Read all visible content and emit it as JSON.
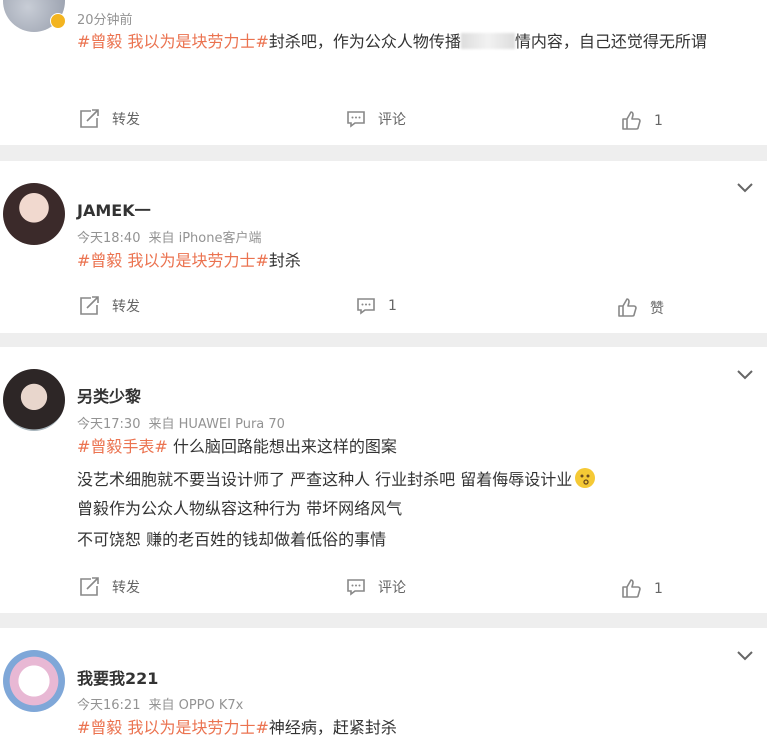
{
  "posts": [
    {
      "time": "20分钟前",
      "source": "",
      "topic": "#曾毅 我以为是块劳力士#",
      "text_before": "封杀吧，作为公众人物传播",
      "text_after": "情内容，自己还觉得无所谓",
      "actions": {
        "repost": "转发",
        "comment": "评论",
        "like": "1"
      }
    },
    {
      "name": "JAMEK一",
      "time": "今天18:40",
      "source": "来自 iPhone客户端",
      "topic": "#曾毅 我以为是块劳力士#",
      "text": "封杀",
      "actions": {
        "repost": "转发",
        "comment": "1",
        "like": "赞"
      }
    },
    {
      "name": "另类少黎",
      "time": "今天17:30",
      "source": "来自 HUAWEI Pura 70",
      "topic": "#曾毅手表#",
      "lines": [
        " 什么脑回路能想出来这样的图案",
        "没艺术细胞就不要当设计师了 严查这种人 行业封杀吧 留着侮辱设计业",
        "曾毅作为公众人物纵容这种行为 带坏网络风气",
        "不可饶恕 赚的老百姓的钱却做着低俗的事情"
      ],
      "actions": {
        "repost": "转发",
        "comment": "评论",
        "like": "1"
      }
    },
    {
      "name": "我要我221",
      "time": "今天16:21",
      "source": "来自 OPPO K7x",
      "topic": "#曾毅 我以为是块劳力士#",
      "text": "神经病，赶紧封杀"
    }
  ],
  "colors": {
    "topic": "#eb7350",
    "meta": "#939393",
    "background": "#eeeeee",
    "badge": "#f3b420"
  },
  "icons": [
    "repost-icon",
    "comment-icon",
    "like-icon",
    "chevron-down-icon",
    "verified-badge-icon",
    "thinking-emoji-icon"
  ]
}
